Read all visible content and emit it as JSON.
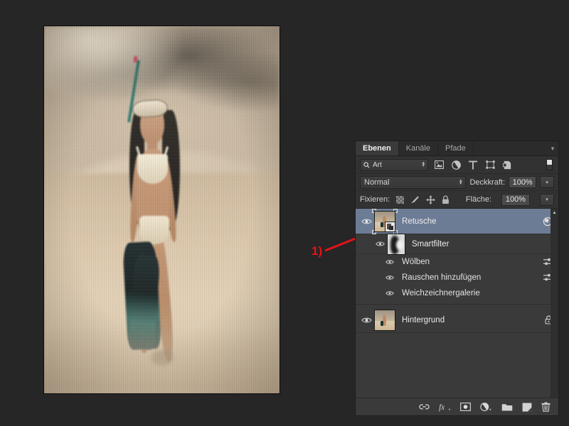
{
  "app": {
    "background_color": "#262626"
  },
  "annotation": {
    "label": "1)",
    "color": "#e8121a",
    "target": "retusche-layer-thumbnail"
  },
  "photo": {
    "alt": "Vintage beach photo of woman with snorkel mask and swim fins",
    "icon": "photo-canvas"
  },
  "panel": {
    "tabs": [
      {
        "label": "Ebenen",
        "active": true
      },
      {
        "label": "Kanäle",
        "active": false
      },
      {
        "label": "Pfade",
        "active": false
      }
    ],
    "menu_icon": "panel-menu-icon",
    "filter_row": {
      "kind_label": "Art",
      "search_icon": "search-icon",
      "icons": [
        "pixel-layer-filter-icon",
        "adjustment-layer-filter-icon",
        "type-layer-filter-icon",
        "shape-layer-filter-icon",
        "smart-object-filter-icon"
      ],
      "toggle_icon": "filter-enable-toggle"
    },
    "blend_row": {
      "mode": "Normal",
      "opacity_label": "Deckkraft:",
      "opacity_value": "100%"
    },
    "lock_row": {
      "label": "Fixieren:",
      "icons": [
        "lock-transparent-pixels-icon",
        "lock-image-pixels-icon",
        "lock-position-icon",
        "lock-all-icon"
      ],
      "fill_label": "Fläche:",
      "fill_value": "100%"
    },
    "layers": [
      {
        "name": "Retusche",
        "selected": true,
        "visible": true,
        "thumb": "smart-object-thumbnail",
        "right_icon": "smart-filter-icon",
        "smart_filters": {
          "name": "Smartfilter",
          "visible": true,
          "mask_thumb": "smart-filter-mask-thumbnail",
          "filters": [
            {
              "name": "Wölben",
              "visible": true,
              "settings_icon": "filter-settings-icon"
            },
            {
              "name": "Rauschen hinzufügen",
              "visible": true,
              "settings_icon": "filter-settings-icon"
            },
            {
              "name": "Weichzeichnergalerie",
              "visible": true,
              "settings_icon": ""
            }
          ]
        }
      },
      {
        "name": "Hintergrund",
        "selected": false,
        "visible": true,
        "thumb": "background-layer-thumbnail",
        "right_icon": "lock-icon"
      }
    ],
    "bottom_bar": {
      "icons": [
        "link-layers-icon",
        "layer-styles-fx-icon",
        "add-layer-mask-icon",
        "new-adjustment-layer-icon",
        "new-group-icon",
        "new-layer-icon",
        "delete-layer-icon"
      ]
    },
    "scrollbar": {
      "up_arrow_icon": "scroll-up-arrow-icon"
    }
  }
}
